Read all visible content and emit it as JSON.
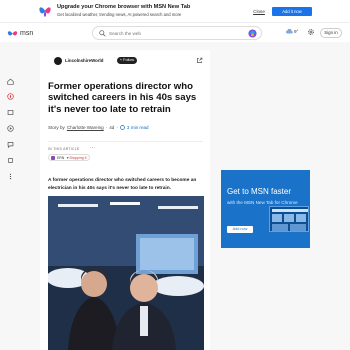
{
  "promo": {
    "title": "Upgrade your Chrome browser with MSN New Tab",
    "subtitle": "Get localized weather, trending news, AI powered search and more",
    "close_label": "Close",
    "add_label": "Add it now"
  },
  "header": {
    "logo_text": "msn",
    "search_placeholder": "Search the web",
    "weather_temp": "9°",
    "signin_label": "Sign in"
  },
  "article": {
    "publisher": "LincolnshireWorld",
    "follow_label": "+ Follow",
    "headline": "Former operations director who switched careers in his 40s says it's never too late to retrain",
    "byline_prefix": "Story by",
    "author": "Charlotte Wareing",
    "age": "4d",
    "read_time": "3 min read",
    "in_this_article_label": "IN THIS ARTICLE",
    "ticker": "ERN",
    "ticker_change": "▼Shopping 5",
    "lede": "A former operations director who switched careers to become an electrician in his 40s says it's never too late to retrain."
  },
  "ad": {
    "title": "Get to MSN faster",
    "subtitle": "with the MSN New Tab for Chrome",
    "button_label": "Add now"
  },
  "colors": {
    "accent": "#1a73e8",
    "ad_bg": "#1a73c9",
    "down": "#d13438"
  }
}
